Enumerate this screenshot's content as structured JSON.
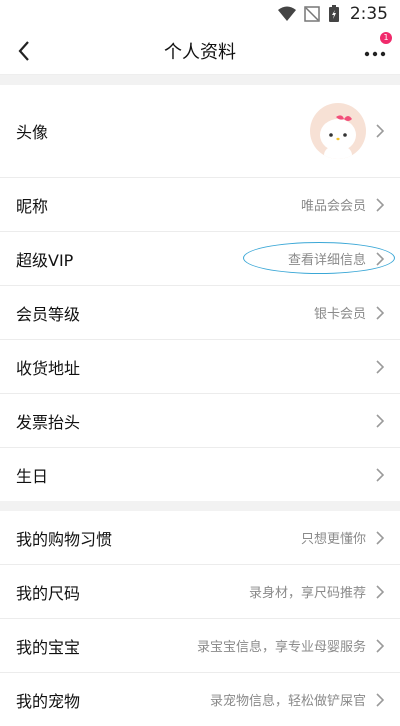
{
  "status_bar": {
    "time": "2:35",
    "icons": [
      "wifi-icon",
      "no-signal-icon",
      "battery-icon"
    ]
  },
  "header": {
    "title": "个人资料",
    "badge_count": "1"
  },
  "profile_section": [
    {
      "label": "头像",
      "value": "",
      "type": "avatar"
    },
    {
      "label": "昵称",
      "value": "唯品会会员"
    },
    {
      "label": "超级VIP",
      "value": "查看详细信息",
      "highlighted": true
    },
    {
      "label": "会员等级",
      "value": "银卡会员"
    },
    {
      "label": "收货地址",
      "value": ""
    },
    {
      "label": "发票抬头",
      "value": ""
    },
    {
      "label": "生日",
      "value": ""
    }
  ],
  "preference_section": [
    {
      "label": "我的购物习惯",
      "value": "只想更懂你"
    },
    {
      "label": "我的尺码",
      "value": "录身材，享尺码推荐"
    },
    {
      "label": "我的宝宝",
      "value": "录宝宝信息，享专业母婴服务"
    },
    {
      "label": "我的宠物",
      "value": "录宠物信息，轻松做铲屎官"
    }
  ],
  "colors": {
    "accent_badge": "#f02a6b",
    "highlight_oval": "#3aa7d6",
    "secondary_text": "#8a8a8a"
  }
}
